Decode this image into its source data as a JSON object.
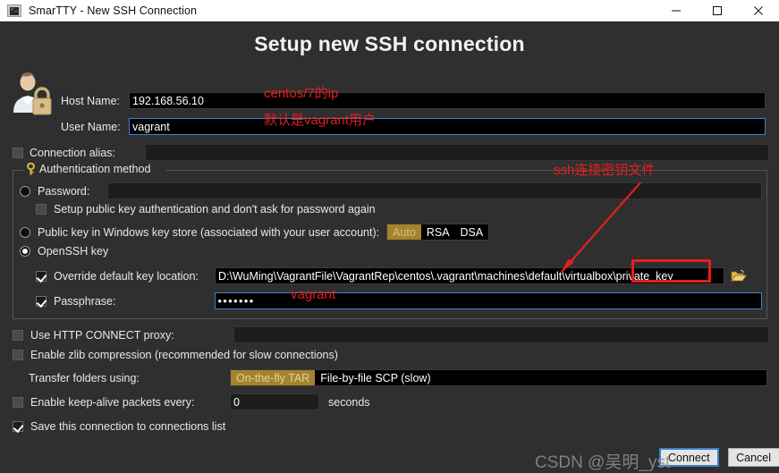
{
  "window": {
    "title": "SmarTTY - New SSH Connection",
    "app_icon": "terminal-icon",
    "minimize": "minimize-icon",
    "maximize": "maximize-icon",
    "close": "close-icon"
  },
  "dialog": {
    "heading": "Setup new SSH connection",
    "avatar_icon": "user-with-lock-icon"
  },
  "host": {
    "label": "Host Name:",
    "value": "192.168.56.10",
    "placeholder": ""
  },
  "user": {
    "label": "User Name:",
    "value": "vagrant",
    "placeholder": ""
  },
  "alias": {
    "label": "Connection alias:",
    "value": "",
    "placeholder": "",
    "checked": false
  },
  "auth": {
    "legend": "Authentication method",
    "legend_icon": "key-icon",
    "password": {
      "label": "Password:",
      "value": "",
      "selected": false
    },
    "setup_pubkey": {
      "label": "Setup public key authentication and don't ask for password again",
      "checked": false
    },
    "winstore": {
      "label": "Public key in Windows key store (associated with your user account):",
      "selected": false,
      "options": [
        "Auto",
        "RSA",
        "DSA"
      ],
      "selected_option": "Auto"
    },
    "openssh": {
      "label": "OpenSSH key",
      "selected": true
    },
    "override_key": {
      "label": "Override default key location:",
      "checked": true,
      "value": "D:\\WuMing\\VagrantFile\\VagrantRep\\centos\\.vagrant\\machines\\default\\virtualbox\\private_key",
      "browse_icon": "open-folder-icon"
    },
    "passphrase": {
      "label": "Passphrase:",
      "checked": true,
      "value": "•••••••"
    }
  },
  "options": {
    "http_proxy": {
      "label": "Use HTTP CONNECT proxy:",
      "checked": false,
      "value": ""
    },
    "zlib": {
      "label": "Enable zlib compression (recommended for slow connections)",
      "checked": false
    },
    "transfer": {
      "label": "Transfer folders using:",
      "options": [
        "On-the-fly TAR",
        "File-by-file SCP (slow)"
      ],
      "selected_option": "On-the-fly TAR"
    },
    "keepalive": {
      "label": "Enable keep-alive packets every:",
      "checked": false,
      "value": "0",
      "unit": "seconds"
    },
    "save": {
      "label": "Save this connection to connections list",
      "checked": true
    }
  },
  "buttons": {
    "connect": "Connect",
    "cancel": "Cancel"
  },
  "annotations": {
    "host_note": "centos/7的ip",
    "user_note": "默认是vagrant用户",
    "key_note": "ssh连接密钥文件",
    "passphrase_note": "vagrant"
  },
  "watermark": "CSDN @吴明_yst",
  "colors": {
    "accent_gold": "#a5832c",
    "annotation_red": "#e81d1d",
    "focus_blue": "#3f7fd0",
    "bg": "#2f2f2f"
  }
}
